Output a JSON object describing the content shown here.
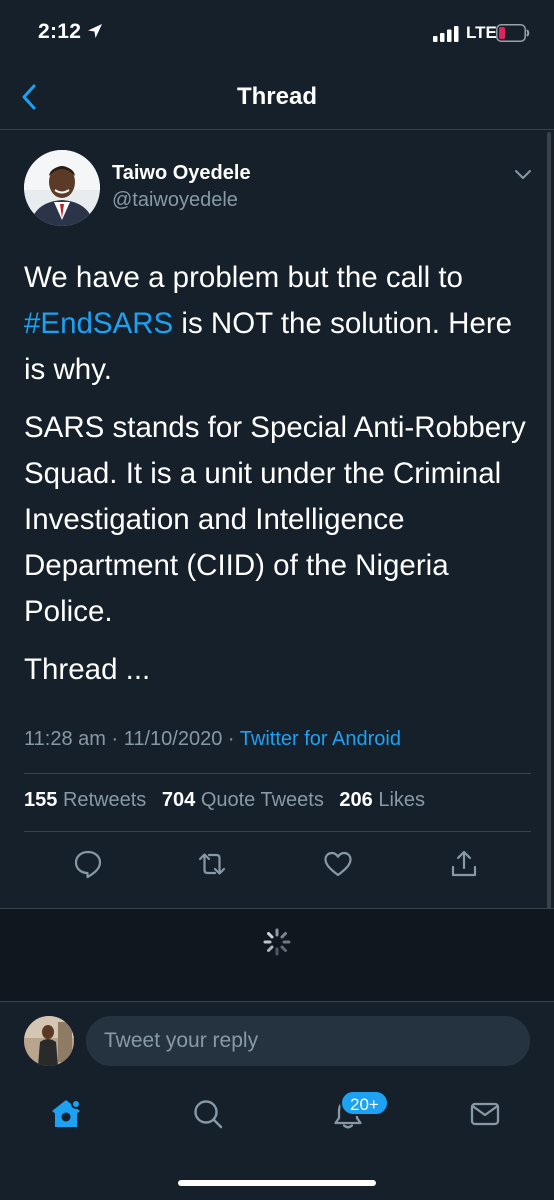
{
  "status_bar": {
    "time": "2:12",
    "network": "LTE"
  },
  "navbar": {
    "title": "Thread"
  },
  "tweet": {
    "author_name": "Taiwo Oyedele",
    "author_handle": "@taiwoyedele",
    "paragraph_1_before": "We have a problem but the call to ",
    "hashtag": "#EndSARS",
    "paragraph_1_after": " is NOT the solution. Here is why.",
    "paragraph_2": "SARS stands for Special Anti-Robbery Squad. It is a unit under the Criminal Investigation and Intelligence Department (CIID) of the Nigeria Police.",
    "paragraph_3": "Thread ...",
    "time": "11:28 am",
    "date": "11/10/2020",
    "source": "Twitter for Android",
    "retweets_count": "155",
    "retweets_label": "Retweets",
    "quotes_count": "704",
    "quotes_label": "Quote Tweets",
    "likes_count": "206",
    "likes_label": "Likes"
  },
  "compose": {
    "placeholder": "Tweet your reply"
  },
  "tabbar": {
    "notifications_badge": "20+"
  },
  "icons": {
    "reply": "reply-icon",
    "retweet": "retweet-icon",
    "like": "heart-icon",
    "share": "share-icon",
    "home": "home-icon",
    "search": "search-icon",
    "notifications": "bell-icon",
    "messages": "mail-icon"
  },
  "colors": {
    "background": "#15202b",
    "accent": "#1da1f2",
    "secondary_text": "#8899a6",
    "divider": "#38444d",
    "battery_low": "#e0245e"
  }
}
